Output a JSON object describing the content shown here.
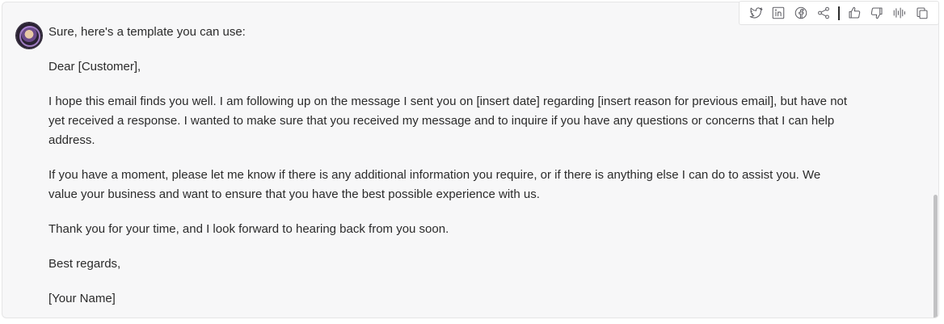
{
  "message": {
    "intro": "Sure, here's a template you can use:",
    "greeting": "Dear [Customer],",
    "body1": "I hope this email finds you well. I am following up on the message I sent you on [insert date] regarding [insert reason for previous email], but have not yet received a response. I wanted to make sure that you received my message and to inquire if you have any questions or concerns that I can help address.",
    "body2": "If you have a moment, please let me know if there is any additional information you require, or if there is anything else I can do to assist you. We value your business and want to ensure that you have the best possible experience with us.",
    "thanks": "Thank you for your time, and I look forward to hearing back from you soon.",
    "closing": "Best regards,",
    "signature": "[Your Name]"
  },
  "toolbar": {
    "icons": [
      "twitter-icon",
      "linkedin-icon",
      "facebook-icon",
      "share-icon",
      "thumbs-up-icon",
      "thumbs-down-icon",
      "audio-waveform-icon",
      "copy-icon"
    ]
  },
  "colors": {
    "card_background": "#f7f7f8",
    "text": "#2b2b2b",
    "icon": "#5f5f65"
  }
}
